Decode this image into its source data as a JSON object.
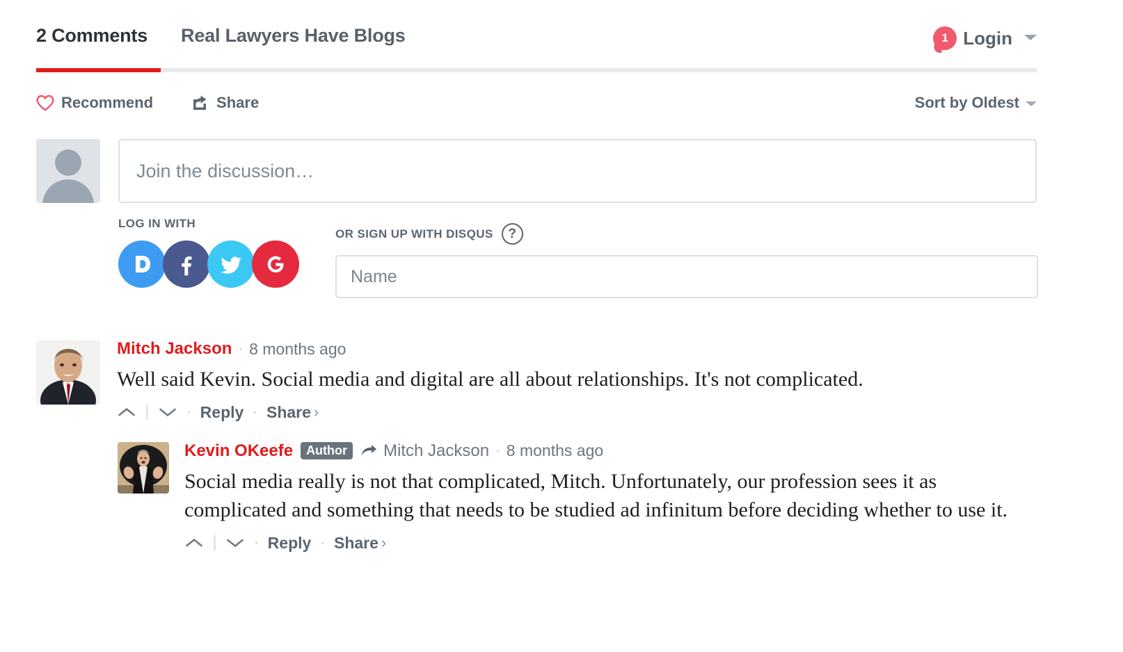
{
  "header": {
    "comments_tab": "2 Comments",
    "site_tab": "Real Lawyers Have Blogs",
    "notification_count": "1",
    "login_label": "Login",
    "active_tab_color": "#e01b1b"
  },
  "actionbar": {
    "recommend_label": "Recommend",
    "share_label": "Share",
    "sort_label": "Sort by Oldest"
  },
  "composer": {
    "textarea_placeholder": "Join the discussion…",
    "log_in_with_label": "LOG IN WITH",
    "or_sign_up_label": "OR SIGN UP WITH DISQUS",
    "help_glyph": "?",
    "name_placeholder": "Name",
    "social": [
      {
        "name": "Disqus",
        "color": "#3e9bf2"
      },
      {
        "name": "Facebook",
        "color": "#4a5a8e"
      },
      {
        "name": "Twitter",
        "color": "#3cc8f5"
      },
      {
        "name": "Google",
        "color": "#e5293e"
      }
    ]
  },
  "comments": [
    {
      "author": "Mitch Jackson",
      "timestamp": "8 months ago",
      "text": "Well said Kevin. Social media and digital are all about relationships. It's not complicated.",
      "reply_label": "Reply",
      "share_label": "Share",
      "share_chevron": "›",
      "separator": "·"
    },
    {
      "author": "Kevin OKeefe",
      "badge": "Author",
      "reply_to": "Mitch Jackson",
      "timestamp": "8 months ago",
      "text": "Social media really is not that complicated, Mitch. Unfortunately, our profession sees it as complicated and something that needs to be studied ad infinitum before deciding whether to use it.",
      "reply_label": "Reply",
      "share_label": "Share",
      "share_chevron": "›",
      "separator": "·"
    }
  ]
}
